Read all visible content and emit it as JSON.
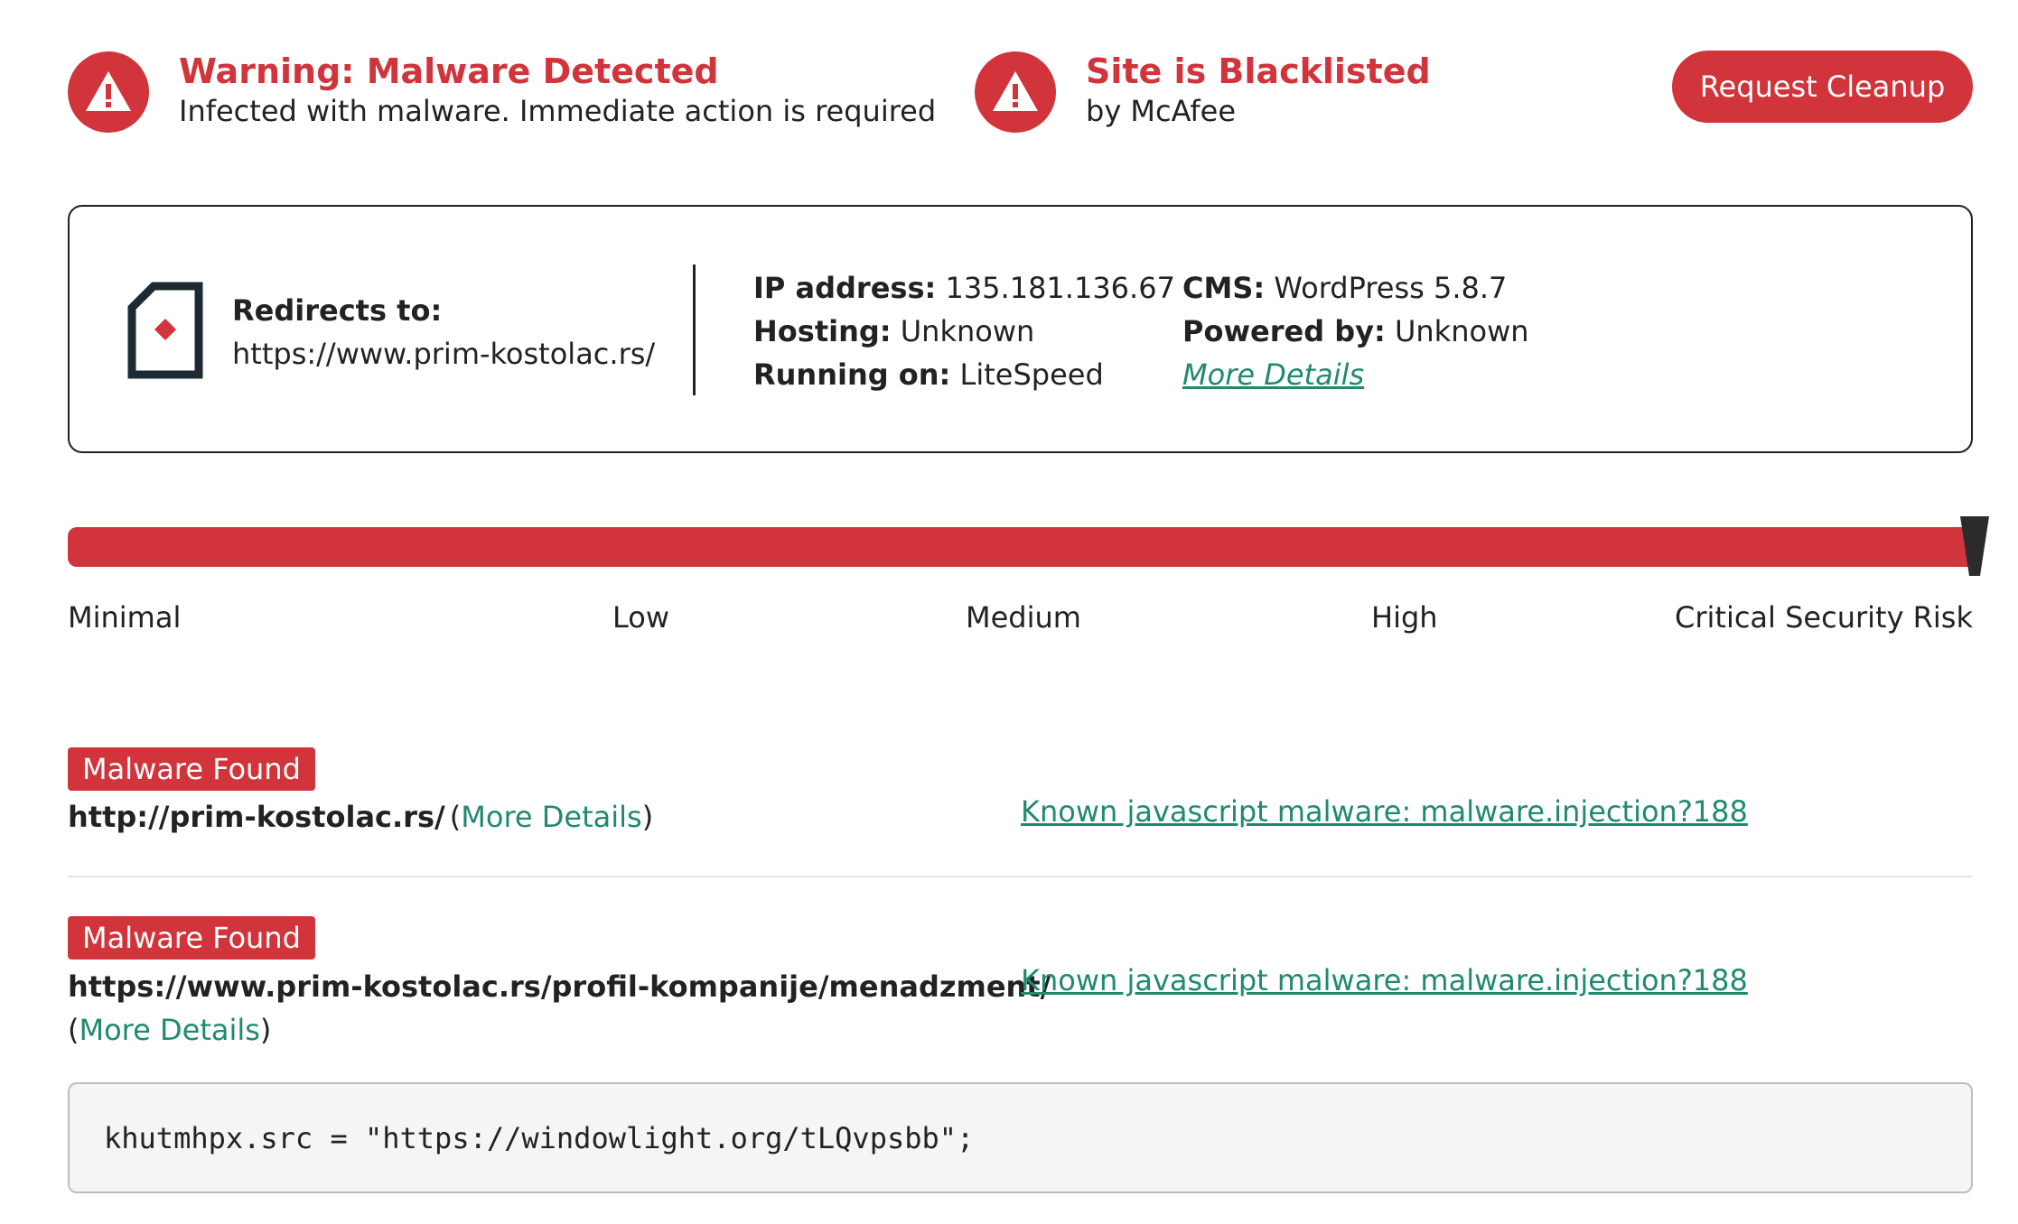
{
  "alerts": [
    {
      "title": "Warning: Malware Detected",
      "subtitle": "Infected with malware. Immediate action is required",
      "icon": "warning-triangle-icon"
    },
    {
      "title": "Site is Blacklisted",
      "subtitle": "by McAfee",
      "icon": "warning-triangle-icon"
    }
  ],
  "cleanup_button": "Request Cleanup",
  "info": {
    "redirect_label": "Redirects to:",
    "redirect_url": "https://www.prim-kostolac.rs/",
    "site_icon": "document-icon",
    "ip_label": "IP address:",
    "ip_value": "135.181.136.67",
    "hosting_label": "Hosting:",
    "hosting_value": "Unknown",
    "running_label": "Running on:",
    "running_value": "LiteSpeed",
    "cms_label": "CMS:",
    "cms_value": "WordPress 5.8.7",
    "powered_label": "Powered by:",
    "powered_value": "Unknown",
    "more_details": "More Details"
  },
  "risk": {
    "labels": [
      "Minimal",
      "Low",
      "Medium",
      "High",
      "Critical Security Risk"
    ],
    "level_fraction": 1.0
  },
  "entries": [
    {
      "badge": "Malware Found",
      "url": "http://prim-kostolac.rs/",
      "more_details": "More Details",
      "malware": "Known javascript malware: malware.injection?188"
    },
    {
      "badge": "Malware Found",
      "url": "https://www.prim-kostolac.rs/profil-kompanije/menadzment/",
      "more_details": "More Details",
      "malware": "Known javascript malware: malware.injection?188",
      "code": "khutmhpx.src = \"https://windowlight.org/tLQvpsbb\";"
    }
  ],
  "colors": {
    "accent": "#d1343a",
    "link": "#1f8a70"
  }
}
